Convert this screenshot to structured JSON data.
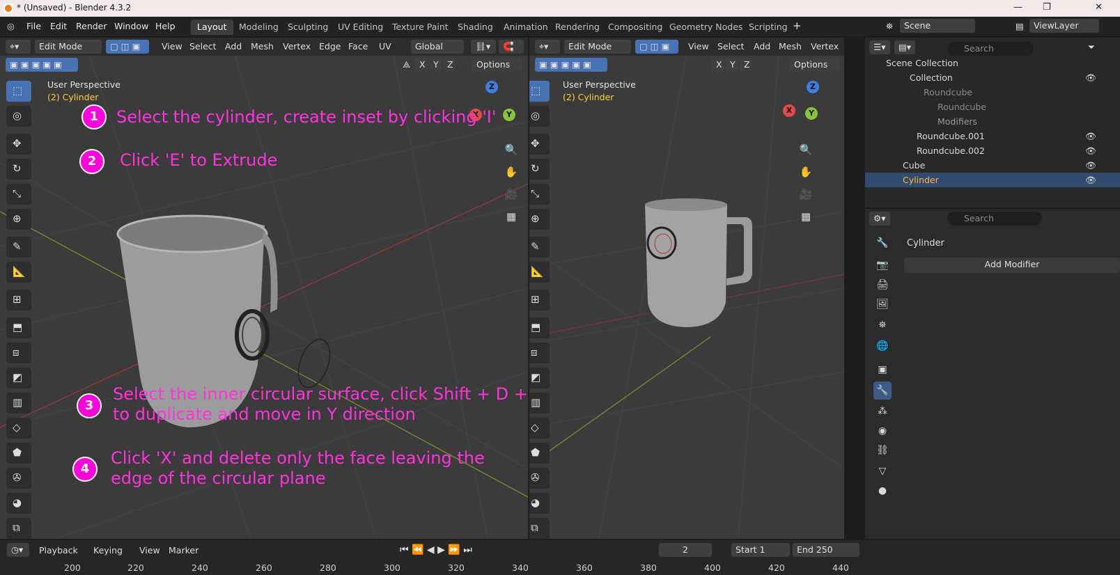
{
  "window": {
    "title": "* (Unsaved) - Blender 4.3.2",
    "minimize": "—",
    "maximize": "❐",
    "close": "✕"
  },
  "menu": [
    "File",
    "Edit",
    "Render",
    "Window",
    "Help"
  ],
  "workspaces": [
    "Layout",
    "Modeling",
    "Sculpting",
    "UV Editing",
    "Texture Paint",
    "Shading",
    "Animation",
    "Rendering",
    "Compositing",
    "Geometry Nodes",
    "Scripting"
  ],
  "add_workspace": "+",
  "scene": {
    "name": "Scene",
    "view_layer": "ViewLayer"
  },
  "viewport_left": {
    "mode": "Edit Mode",
    "menus": [
      "View",
      "Select",
      "Add",
      "Mesh",
      "Vertex",
      "Edge",
      "Face",
      "UV"
    ],
    "orientation": "Global",
    "options": "Options",
    "axes": [
      "X",
      "Y",
      "Z"
    ],
    "perspective": "User Perspective",
    "object": "(2) Cylinder"
  },
  "viewport_right": {
    "mode": "Edit Mode",
    "menus": [
      "View",
      "Select",
      "Add",
      "Mesh",
      "Vertex"
    ],
    "options": "Options",
    "axes": [
      "X",
      "Y",
      "Z"
    ],
    "perspective": "User Perspective",
    "object": "(2) Cylinder"
  },
  "gizmo": {
    "x": "X",
    "y": "Y",
    "z": "Z"
  },
  "instructions": [
    {
      "n": "1",
      "line1": "Select the cylinder, create inset by clicking 'I'",
      "line2": ""
    },
    {
      "n": "2",
      "line1": "Click 'E' to Extrude",
      "line2": ""
    },
    {
      "n": "3",
      "line1": "Select the inner circular surface, click Shift + D + Y",
      "line2": "to duplicate and move in Y direction"
    },
    {
      "n": "4",
      "line1": "Click 'X' and delete only the face leaving the",
      "line2": "edge of the circular plane"
    }
  ],
  "outliner": {
    "search": "Search",
    "root": "Scene Collection",
    "rows": [
      {
        "label": "Collection"
      },
      {
        "label": "Roundcube"
      },
      {
        "label": "Roundcube"
      },
      {
        "label": "Modifiers"
      },
      {
        "label": "Roundcube.001"
      },
      {
        "label": "Roundcube.002"
      },
      {
        "label": "Cube"
      },
      {
        "label": "Cylinder"
      }
    ]
  },
  "properties": {
    "search": "Search",
    "object": "Cylinder",
    "add_modifier": "Add Modifier"
  },
  "timeline": {
    "menus": [
      "Playback",
      "Keying",
      "View",
      "Marker"
    ],
    "current_frame": "2",
    "start_label": "Start",
    "start": "1",
    "end_label": "End",
    "end": "250",
    "ruler": [
      "200",
      "220",
      "240",
      "260",
      "280",
      "300",
      "320",
      "340",
      "360",
      "380",
      "400",
      "420",
      "440"
    ]
  },
  "colors": {
    "accent": "#4772b3",
    "instruction": "#ff33dd",
    "select": "#ffcf3a"
  }
}
